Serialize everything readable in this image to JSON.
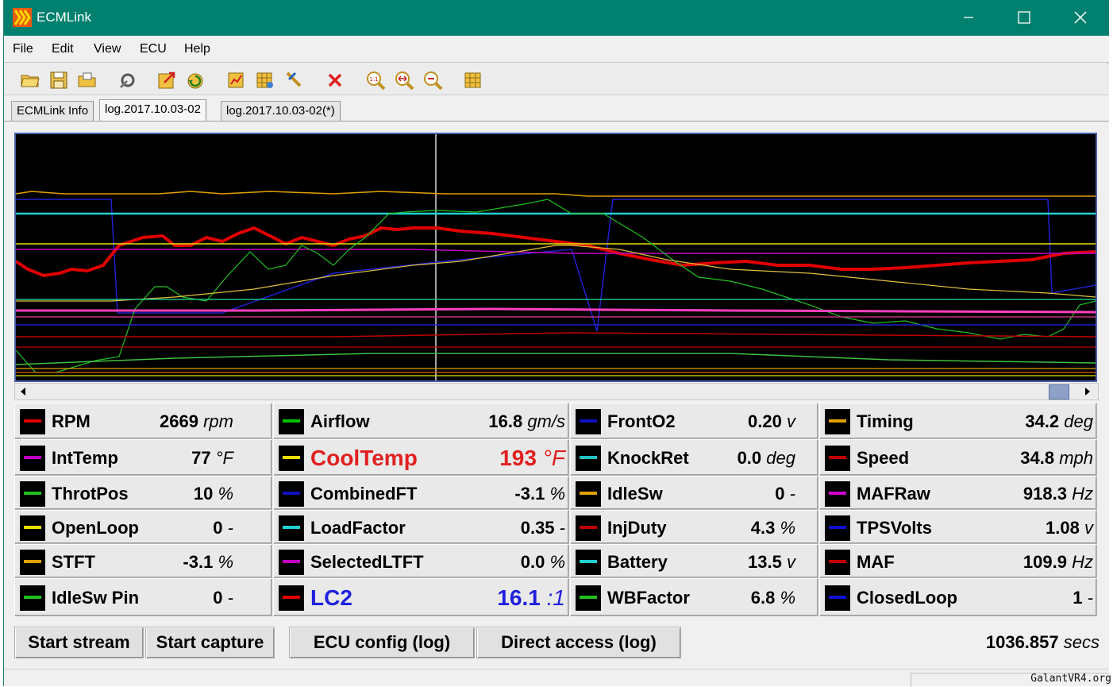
{
  "window": {
    "title": "ECMLink"
  },
  "menu": [
    {
      "key": "F",
      "rest": "ile"
    },
    {
      "key": "E",
      "rest": "dit"
    },
    {
      "key": "V",
      "rest": "iew"
    },
    {
      "key": "E",
      "pre": "",
      "label": "ECU"
    },
    {
      "key": "H",
      "rest": "elp"
    }
  ],
  "menu_labels": {
    "file": "File",
    "edit": "Edit",
    "view": "View",
    "ecu": "ECU",
    "help": "Help"
  },
  "toolbar_icons": [
    "open-folder-icon",
    "save-icon",
    "open-log-icon",
    "settings-icon",
    "export-icon",
    "refresh-icon",
    "chart-settings-icon",
    "table-settings-icon",
    "tool-icon",
    "delete-icon",
    "zoom-reset-icon",
    "zoom-fit-icon",
    "zoom-out-icon",
    "grid-icon"
  ],
  "tabs": [
    "ECMLink Info",
    "log.2017.10.03-02",
    "log.2017.10.03-02(*)"
  ],
  "active_tab": 1,
  "params": [
    {
      "label": "RPM",
      "value": "2669",
      "unit": "rpm",
      "color": "#e00000"
    },
    {
      "label": "Airflow",
      "value": "16.8",
      "unit": "gm/s",
      "color": "#00c000"
    },
    {
      "label": "FrontO2",
      "value": "0.20",
      "unit": "v",
      "color": "#1010c0"
    },
    {
      "label": "Timing",
      "value": "34.2",
      "unit": "deg",
      "color": "#e0a000"
    },
    {
      "label": "IntTemp",
      "value": "77",
      "unit": "°F",
      "color": "#c000c0"
    },
    {
      "label": "CoolTemp",
      "value": "193",
      "unit": "°F",
      "color": "#f0e000",
      "textColor": "#e02020"
    },
    {
      "label": "KnockRet",
      "value": "0.0",
      "unit": "deg",
      "color": "#20c0c0"
    },
    {
      "label": "Speed",
      "value": "34.8",
      "unit": "mph",
      "color": "#c00000"
    },
    {
      "label": "ThrotPos",
      "value": "10",
      "unit": "%",
      "color": "#20c020"
    },
    {
      "label": "CombinedFT",
      "value": "-3.1",
      "unit": "%",
      "color": "#1010c0"
    },
    {
      "label": "IdleSw",
      "value": "0",
      "unit": "-",
      "color": "#e0a000"
    },
    {
      "label": "MAFRaw",
      "value": "918.3",
      "unit": "Hz",
      "color": "#d000d0"
    },
    {
      "label": "OpenLoop",
      "value": "0",
      "unit": "-",
      "color": "#e8e000"
    },
    {
      "label": "LoadFactor",
      "value": "0.35",
      "unit": "-",
      "color": "#20d0d0"
    },
    {
      "label": "InjDuty",
      "value": "4.3",
      "unit": "%",
      "color": "#c00000"
    },
    {
      "label": "TPSVolts",
      "value": "1.08",
      "unit": "v",
      "color": "#1010d0"
    },
    {
      "label": "STFT",
      "value": "-3.1",
      "unit": "%",
      "color": "#e0a000"
    },
    {
      "label": "SelectedLTFT",
      "value": "0.0",
      "unit": "%",
      "color": "#c000c0"
    },
    {
      "label": "Battery",
      "value": "13.5",
      "unit": "v",
      "color": "#20d0d0"
    },
    {
      "label": "MAF",
      "value": "109.9",
      "unit": "Hz",
      "color": "#c00000"
    },
    {
      "label": "IdleSw Pin",
      "value": "0",
      "unit": "-",
      "color": "#20c020"
    },
    {
      "label": "LC2",
      "value": "16.1",
      "unit": ":1",
      "color": "#e00000",
      "textColor": "#2020e0"
    },
    {
      "label": "WBFactor",
      "value": "6.8",
      "unit": "%",
      "color": "#20c020"
    },
    {
      "label": "ClosedLoop",
      "value": "1",
      "unit": "-",
      "color": "#1010d0"
    }
  ],
  "buttons": {
    "start_stream": "Start stream",
    "start_capture": "Start capture",
    "ecu_config": "ECU config (log)",
    "direct_access": "Direct access (log)"
  },
  "elapsed": {
    "value": "1036.857",
    "unit": "secs"
  },
  "watermark": "GalantVR4.org"
}
